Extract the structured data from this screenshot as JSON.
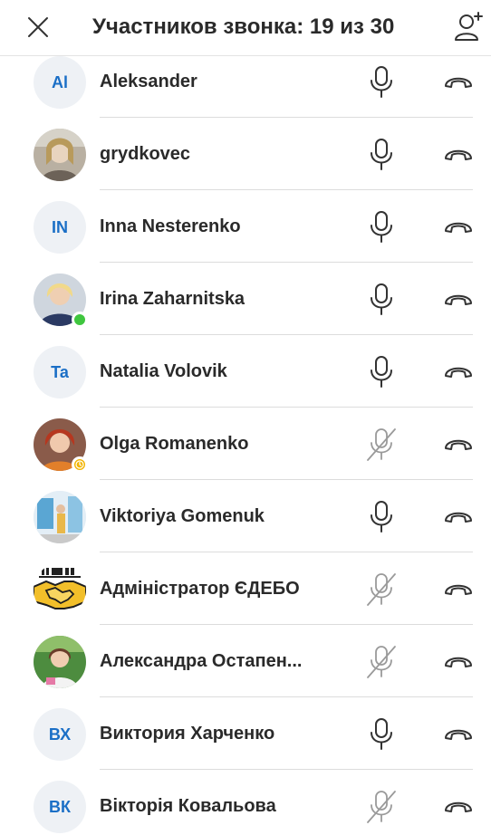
{
  "header": {
    "title": "Участников звонка: 19 из 30"
  },
  "participants": [
    {
      "name": "Aleksander",
      "initials": "Al",
      "avatar": "initials",
      "muted": false,
      "status": "none"
    },
    {
      "name": "grydkovec",
      "initials": "",
      "avatar": "photo-grey",
      "muted": false,
      "status": "none"
    },
    {
      "name": "Inna Nesterenko",
      "initials": "IN",
      "avatar": "initials",
      "muted": false,
      "status": "none"
    },
    {
      "name": "Irina Zaharnitska",
      "initials": "",
      "avatar": "photo-blonde",
      "muted": false,
      "status": "online"
    },
    {
      "name": "Natalia Volovik",
      "initials": "Ta",
      "avatar": "initials",
      "muted": false,
      "status": "none"
    },
    {
      "name": "Olga Romanenko",
      "initials": "",
      "avatar": "photo-red",
      "muted": true,
      "status": "away"
    },
    {
      "name": "Viktoriya Gomenuk",
      "initials": "",
      "avatar": "photo-stand",
      "muted": false,
      "status": "none"
    },
    {
      "name": "Адміністратор ЄДЕБО",
      "initials": "",
      "avatar": "logo-handshake",
      "muted": true,
      "status": "none"
    },
    {
      "name": "Александра Остапен...",
      "initials": "",
      "avatar": "photo-green",
      "muted": true,
      "status": "none"
    },
    {
      "name": "Виктория Харченко",
      "initials": "ВХ",
      "avatar": "initials",
      "muted": false,
      "status": "none"
    },
    {
      "name": "Вікторія Ковальова",
      "initials": "ВК",
      "avatar": "initials",
      "muted": true,
      "status": "none"
    }
  ],
  "colors": {
    "initials": "#1b6fc6",
    "avatar_bg": "#eef1f5",
    "online": "#3fc63f",
    "away": "#f2b400",
    "icon_active": "#333333",
    "icon_muted": "#9a9a9a",
    "separator": "#dcdcdc"
  },
  "icons": {
    "close": "close-icon",
    "add_participant": "add-person-icon",
    "mic": "microphone-icon",
    "mic_muted": "microphone-muted-icon",
    "hangup": "hang-up-icon"
  }
}
